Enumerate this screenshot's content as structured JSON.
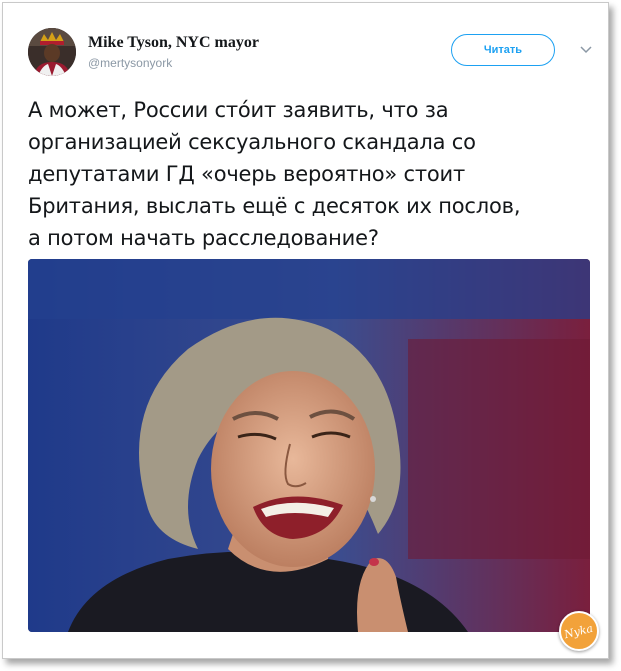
{
  "tweet": {
    "author_name": "Mike Tyson, NYC mayor",
    "author_handle": "@mertysonyork",
    "follow_label": "Читать",
    "text": "А может, России стóит заявить, что за\nорганизацией сексуального скандала со\nдепутатами ГД «очерь вероятно» стоит\nБритания, выслать ещё с десяток их послов,\nа потом начать расследование?",
    "menu_icon": "chevron-down-icon",
    "avatar_icon": "avatar",
    "photo": "woman-grimacing-photo"
  },
  "watermark": {
    "text": "Nyka",
    "color": "#f2a23a"
  },
  "colors": {
    "accent": "#1da1f2",
    "text": "#14171a",
    "muted": "#8b98a5"
  }
}
